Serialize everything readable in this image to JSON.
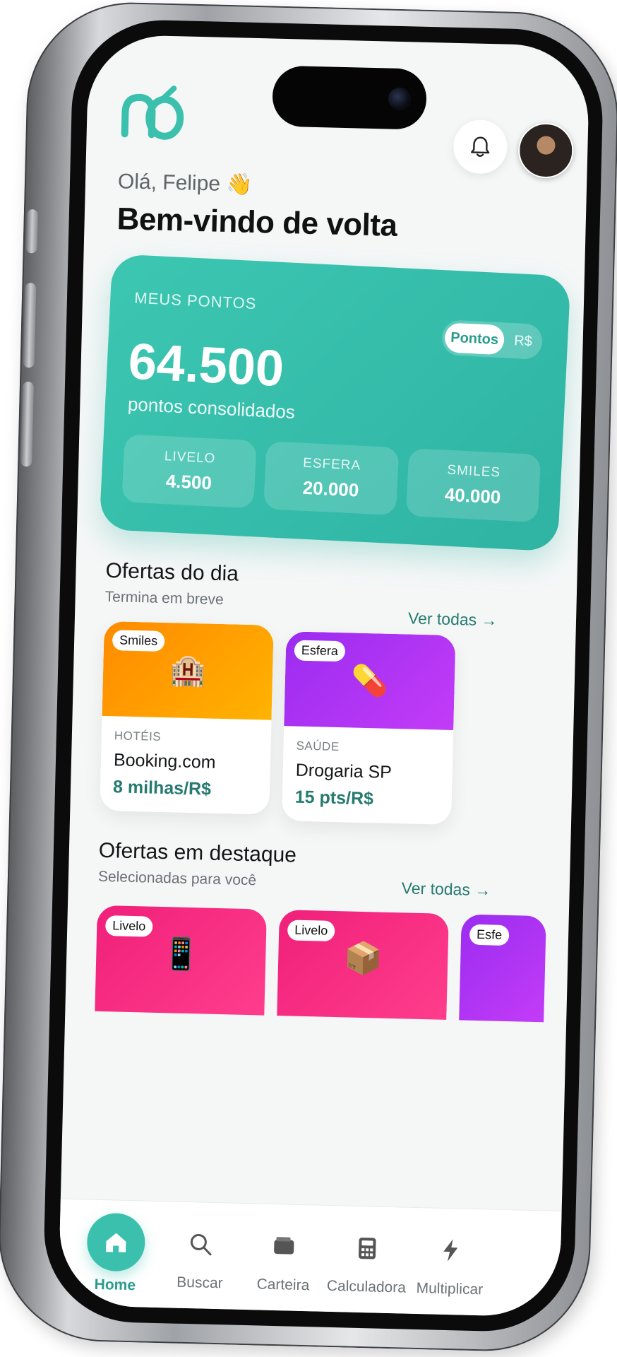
{
  "header": {
    "greeting": "Olá, Felipe 👋",
    "title": "Bem-vindo de volta"
  },
  "points_card": {
    "label": "MEUS PONTOS",
    "toggle_selected": "Pontos",
    "toggle_other": "R$",
    "total": "64.500",
    "total_caption": "pontos consolidados",
    "programs": [
      {
        "name": "LIVELO",
        "value": "4.500"
      },
      {
        "name": "ESFERA",
        "value": "20.000"
      },
      {
        "name": "SMILES",
        "value": "40.000"
      }
    ]
  },
  "daily_offers": {
    "title": "Ofertas do dia",
    "subtitle": "Termina em breve",
    "see_all": "Ver todas →",
    "items": [
      {
        "badge": "Smiles",
        "icon": "🏨",
        "category": "HOTÉIS",
        "name": "Booking.com",
        "rate": "8 milhas/R$"
      },
      {
        "badge": "Esfera",
        "icon": "💊",
        "category": "SAÚDE",
        "name": "Drogaria SP",
        "rate": "15 pts/R$"
      }
    ]
  },
  "featured_offers": {
    "title": "Ofertas em destaque",
    "subtitle": "Selecionadas para você",
    "see_all": "Ver todas →",
    "items": [
      {
        "badge": "Livelo",
        "icon": "📱"
      },
      {
        "badge": "Livelo",
        "icon": "📦"
      },
      {
        "badge": "Esfe"
      }
    ]
  },
  "tabbar": {
    "items": [
      {
        "label": "Home",
        "icon": "home-icon",
        "active": true
      },
      {
        "label": "Buscar",
        "icon": "search-icon"
      },
      {
        "label": "Carteira",
        "icon": "wallet-icon"
      },
      {
        "label": "Calculadora",
        "icon": "calculator-icon"
      },
      {
        "label": "Multiplicar",
        "icon": "bolt-icon"
      }
    ]
  },
  "colors": {
    "accent": "#3cc0ae",
    "accent_text": "#267a70",
    "smiles_gradient": [
      "#ff8a00",
      "#ffb300"
    ],
    "esfera_gradient": [
      "#9b2cf0",
      "#c33cf7"
    ],
    "livelo_gradient": [
      "#f0207a",
      "#ff3d8c"
    ]
  }
}
